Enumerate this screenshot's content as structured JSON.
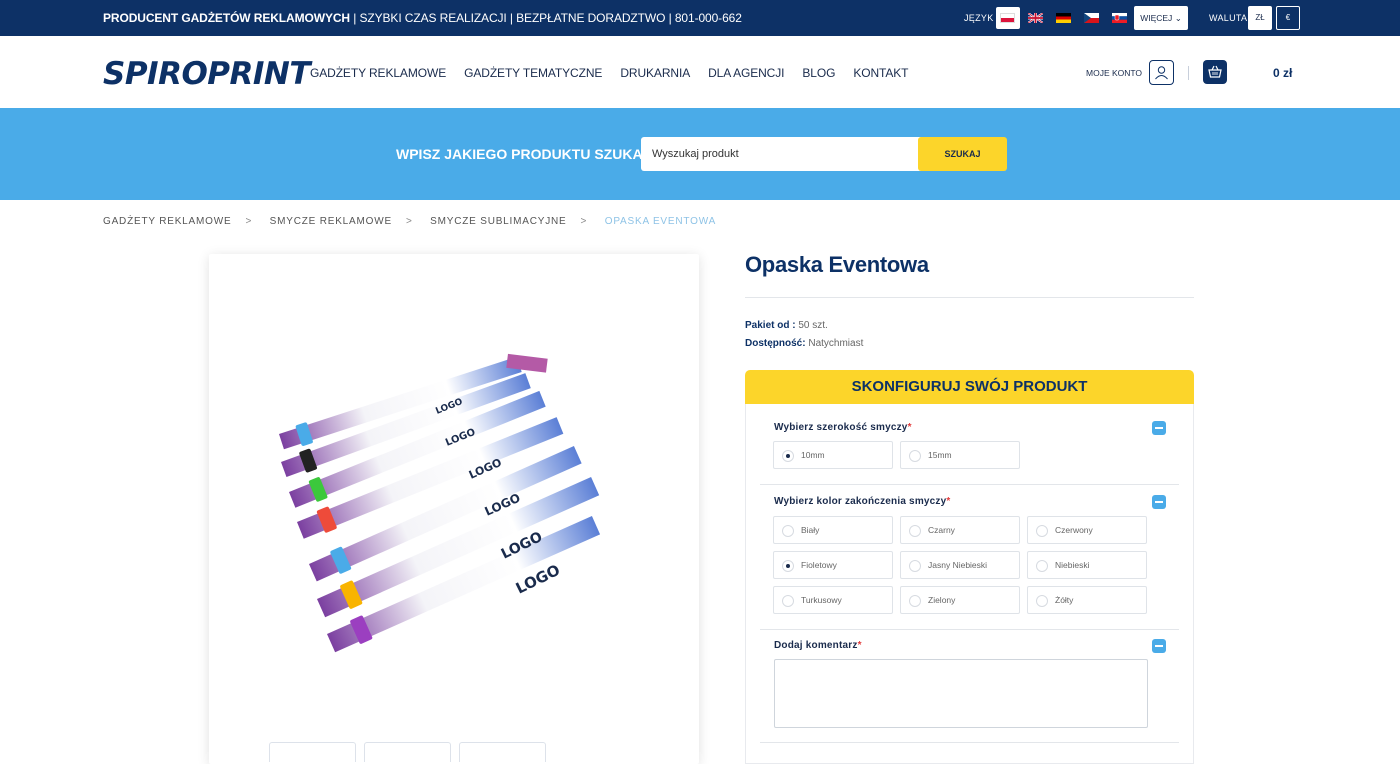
{
  "topbar": {
    "promo_bold": "PRODUCENT GADŻETÓW REKLAMOWYCH",
    "promo_rest": " | SZYBKI CZAS REALIZACJI | BEZPŁATNE DORADZTWO | 801-000-662",
    "language_label": "JĘZYK",
    "more_label": "WIĘCEJ",
    "currency_label": "WALUTA",
    "currencies": [
      "ZŁ",
      "€"
    ]
  },
  "header": {
    "logo": "SPIROPRINT",
    "nav": [
      "GADŻETY REKLAMOWE",
      "GADŻETY TEMATYCZNE",
      "DRUKARNIA",
      "DLA AGENCJI",
      "BLOG",
      "KONTAKT"
    ],
    "account_label": "MOJE KONTO",
    "cart_total": "0 zł"
  },
  "search": {
    "prompt": "WPISZ JAKIEGO PRODUKTU SZUKASZ",
    "placeholder": "Wyszukaj produkt",
    "button": "SZUKAJ"
  },
  "breadcrumb": [
    "GADŻETY REKLAMOWE",
    "SMYCZE REKLAMOWE",
    "SMYCZE SUBLIMACYJNE",
    "OPASKA EVENTOWA"
  ],
  "product": {
    "title": "Opaska Eventowa",
    "package_label": "Pakiet od :",
    "package_value": "50 szt.",
    "availability_label": "Dostępność:",
    "availability_value": "Natychmiast",
    "wristband_logo_text": "LOGO"
  },
  "configurator": {
    "heading": "SKONFIGURUJ SWÓJ PRODUKT",
    "width_title": "Wybierz szerokość smyczy",
    "width_options": [
      "10mm",
      "15mm"
    ],
    "color_title": "Wybierz kolor zakończenia smyczy",
    "color_options": [
      "Biały",
      "Czarny",
      "Czerwony",
      "Fioletowy",
      "Jasny Niebieski",
      "Niebieski",
      "Turkusowy",
      "Zielony",
      "Żółty"
    ],
    "comment_title": "Dodaj komentarz",
    "required_mark": "*"
  },
  "colors": {
    "navy": "#0d3166",
    "sky": "#4aabe8",
    "yellow": "#fcd52a"
  }
}
